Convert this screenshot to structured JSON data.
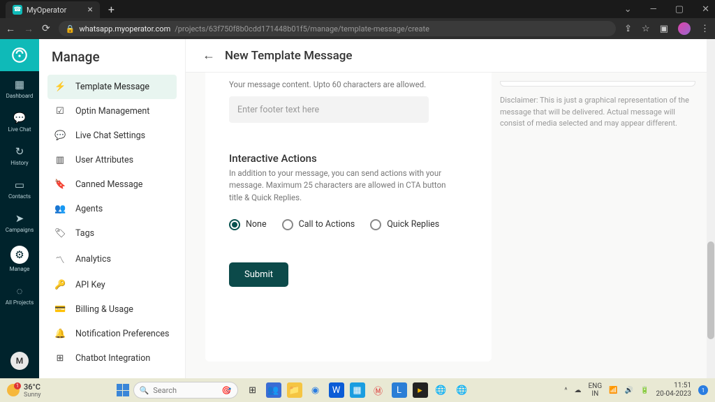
{
  "browser": {
    "tab_title": "MyOperator",
    "url_domain": "whatsapp.myoperator.com",
    "url_path": "/projects/63f750f8b0cdd171448b01f5/manage/template-message/create"
  },
  "rail": {
    "items": [
      {
        "label": "Dashboard"
      },
      {
        "label": "Live Chat"
      },
      {
        "label": "History"
      },
      {
        "label": "Contacts"
      },
      {
        "label": "Campaigns"
      },
      {
        "label": "Manage"
      },
      {
        "label": "All Projects"
      }
    ],
    "avatar_initial": "M"
  },
  "sidebar": {
    "title": "Manage",
    "items": [
      {
        "label": "Template Message"
      },
      {
        "label": "Optin Management"
      },
      {
        "label": "Live Chat Settings"
      },
      {
        "label": "User Attributes"
      },
      {
        "label": "Canned Message"
      },
      {
        "label": "Agents"
      },
      {
        "label": "Tags"
      },
      {
        "label": "Analytics"
      },
      {
        "label": "API Key"
      },
      {
        "label": "Billing & Usage"
      },
      {
        "label": "Notification Preferences"
      },
      {
        "label": "Chatbot Integration"
      }
    ]
  },
  "page": {
    "title": "New Template Message",
    "footer_helper": "Your message content. Upto 60 characters are allowed.",
    "footer_placeholder": "Enter footer text here",
    "interactive_title": "Interactive Actions",
    "interactive_desc": "In addition to your message, you can send actions with your message. Maximum 25 characters are allowed in CTA button title & Quick Replies.",
    "radio": {
      "none": "None",
      "cta": "Call to Actions",
      "quick": "Quick Replies"
    },
    "submit": "Submit",
    "disclaimer": "Disclaimer: This is just a graphical representation of the message that will be delivered. Actual message will consist of media selected and may appear different."
  },
  "taskbar": {
    "temp": "36°C",
    "cond": "Sunny",
    "search": "Search",
    "lang": "ENG",
    "region": "IN",
    "time": "11:51",
    "date": "20-04-2023"
  }
}
